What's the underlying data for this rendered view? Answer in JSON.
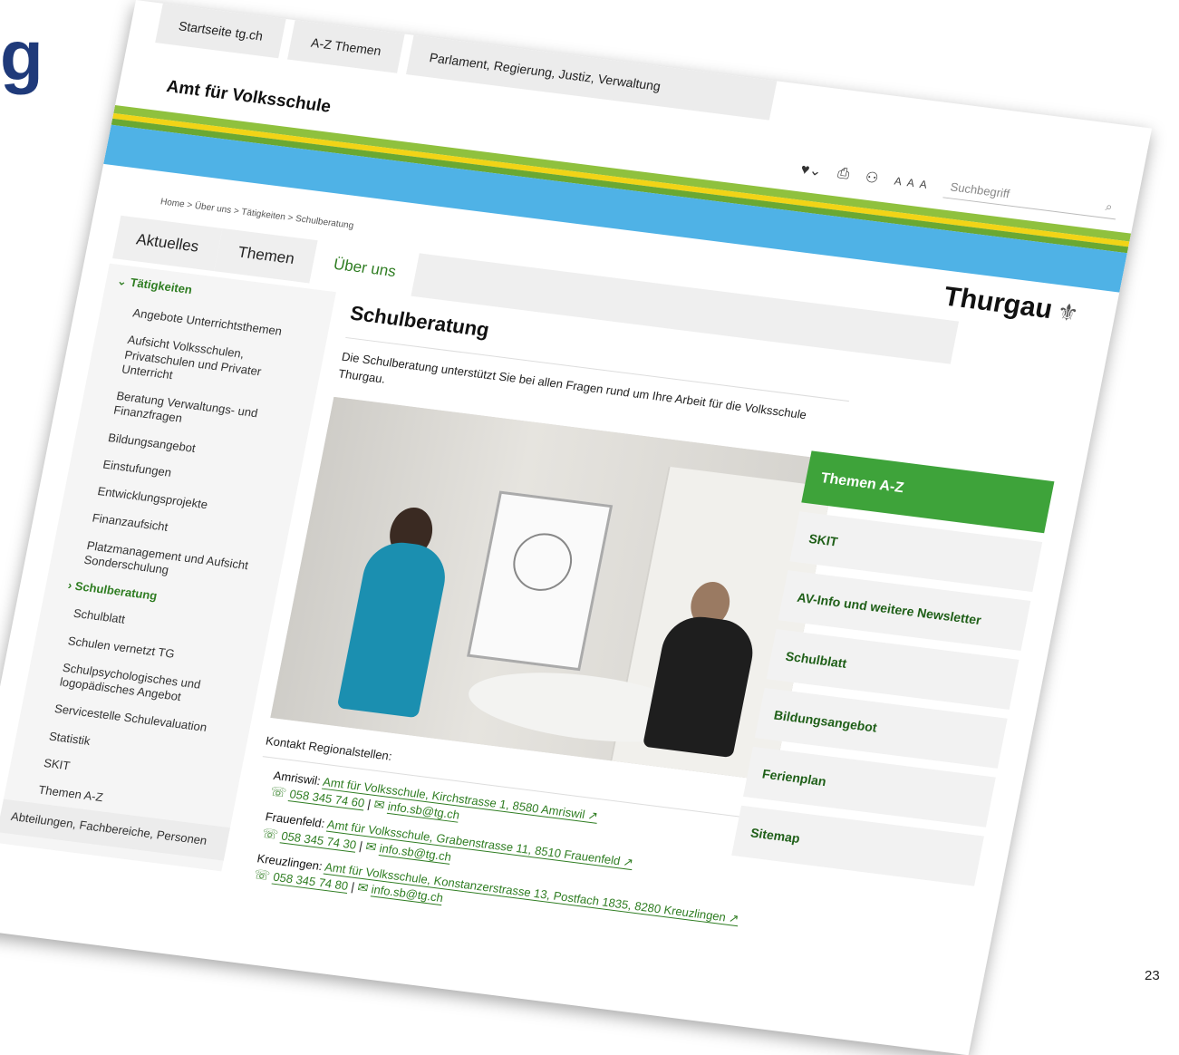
{
  "slide": {
    "title_fragment": "g",
    "page_number": "23"
  },
  "top_nav": [
    "Startseite tg.ch",
    "A-Z Themen",
    "Parlament, Regierung, Justiz, Verwaltung"
  ],
  "site_title": "Amt für Volksschule",
  "tools": {
    "font_size_labels": "A A A",
    "search_placeholder": "Suchbegriff"
  },
  "logo": "Thurgau",
  "breadcrumb": "Home  >  Über uns  >  Tätigkeiten  >  Schulberatung",
  "main_tabs": [
    "Aktuelles",
    "Themen",
    "Über uns"
  ],
  "sidebar": {
    "head": "Tätigkeiten",
    "items": [
      "Angebote Unterrichtsthemen",
      "Aufsicht Volksschulen, Privatschulen und Privater Unterricht",
      "Beratung Verwaltungs- und Finanzfragen",
      "Bildungsangebot",
      "Einstufungen",
      "Entwicklungsprojekte",
      "Finanzaufsicht",
      "Platzmanagement und Aufsicht Sonderschulung",
      "Schulberatung",
      "Schulblatt",
      "Schulen vernetzt TG",
      "Schulpsychologisches und logopädisches Angebot",
      "Servicestelle Schulevaluation",
      "Statistik",
      "SKIT",
      "Themen A-Z"
    ],
    "bottom": "Abteilungen, Fachbereiche, Personen"
  },
  "content": {
    "title": "Schulberatung",
    "intro": "Die Schulberatung unterstützt Sie bei allen Fragen rund um Ihre Arbeit für die Volksschule Thurgau.",
    "contact_title": "Kontakt Regionalstellen:",
    "contacts": [
      {
        "place": "Amriswil:",
        "address": "Amt für Volksschule, Kirchstrasse 1, 8580 Amriswil ↗",
        "phone": "058 345 74 60",
        "email": "info.sb@tg.ch"
      },
      {
        "place": "Frauenfeld:",
        "address": "Amt für Volksschule, Grabenstrasse 11, 8510 Frauenfeld ↗",
        "phone": "058 345 74 30",
        "email": "info.sb@tg.ch"
      },
      {
        "place": "Kreuzlingen:",
        "address": "Amt für Volksschule, Konstanzerstrasse 13, Postfach 1835, 8280 Kreuzlingen ↗",
        "phone": "058 345 74 80",
        "email": "info.sb@tg.ch"
      }
    ]
  },
  "right_col": [
    "Themen A-Z",
    "SKIT",
    "AV-Info und weitere Newsletter",
    "Schulblatt",
    "Bildungsangebot",
    "Ferienplan",
    "Sitemap"
  ]
}
